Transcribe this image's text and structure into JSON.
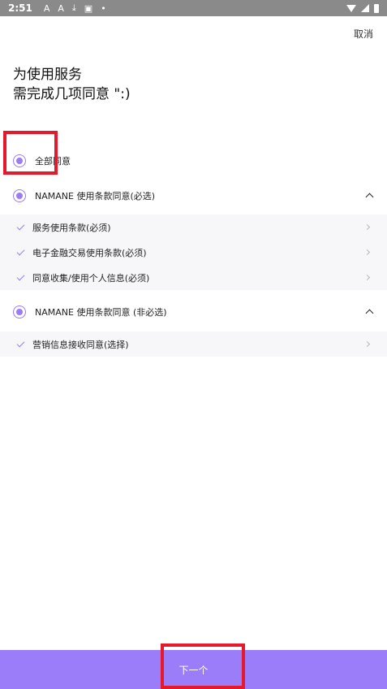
{
  "status_bar": {
    "time": "2:51",
    "icons": [
      "A-icon",
      "A-icon",
      "download-icon",
      "a-icon",
      "dot-icon"
    ]
  },
  "header": {
    "cancel_label": "取消"
  },
  "title": {
    "line1": "为使用服务",
    "line2": "需完成几项同意 \":)"
  },
  "agree_all": {
    "label": "全部同意"
  },
  "required_group": {
    "label": "NAMANE 使用条款同意(必选)",
    "items": [
      {
        "label": "服务使用条款(必须)"
      },
      {
        "label": "电子金融交易使用条款(必须)"
      },
      {
        "label": "同意收集/使用个人信息(必须)"
      }
    ]
  },
  "optional_group": {
    "label": "NAMANE 使用条款同意 (非必选)",
    "items": [
      {
        "label": "营销信息接收同意(选择)"
      }
    ]
  },
  "footer": {
    "next_label": "下一个"
  },
  "colors": {
    "accent": "#9b7cf9",
    "highlight": "#e5192b"
  }
}
